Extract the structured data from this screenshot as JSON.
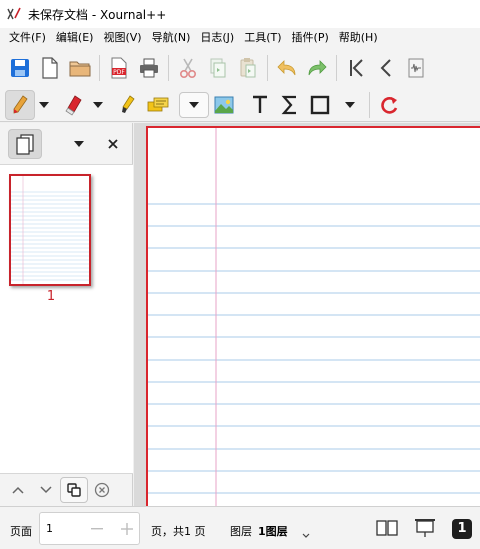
{
  "window": {
    "title": "未保存文档 - Xournal++"
  },
  "menu": [
    {
      "label": "文件(F)"
    },
    {
      "label": "编辑(E)"
    },
    {
      "label": "视图(V)"
    },
    {
      "label": "导航(N)"
    },
    {
      "label": "日志(J)"
    },
    {
      "label": "工具(T)"
    },
    {
      "label": "插件(P)"
    },
    {
      "label": "帮助(H)"
    }
  ],
  "sidebar": {
    "thumbnails": [
      {
        "label": "1"
      }
    ]
  },
  "statusbar": {
    "page_label": "页面",
    "page_value": "1",
    "page_total": "页，共1 页",
    "layer_label": "图层",
    "layer_value": "1图层",
    "page_number_badge": "1"
  },
  "colors": {
    "accent_red": "#d9262e",
    "ruled_line": "#a9cbe8",
    "margin_line": "#e7a3c7"
  }
}
